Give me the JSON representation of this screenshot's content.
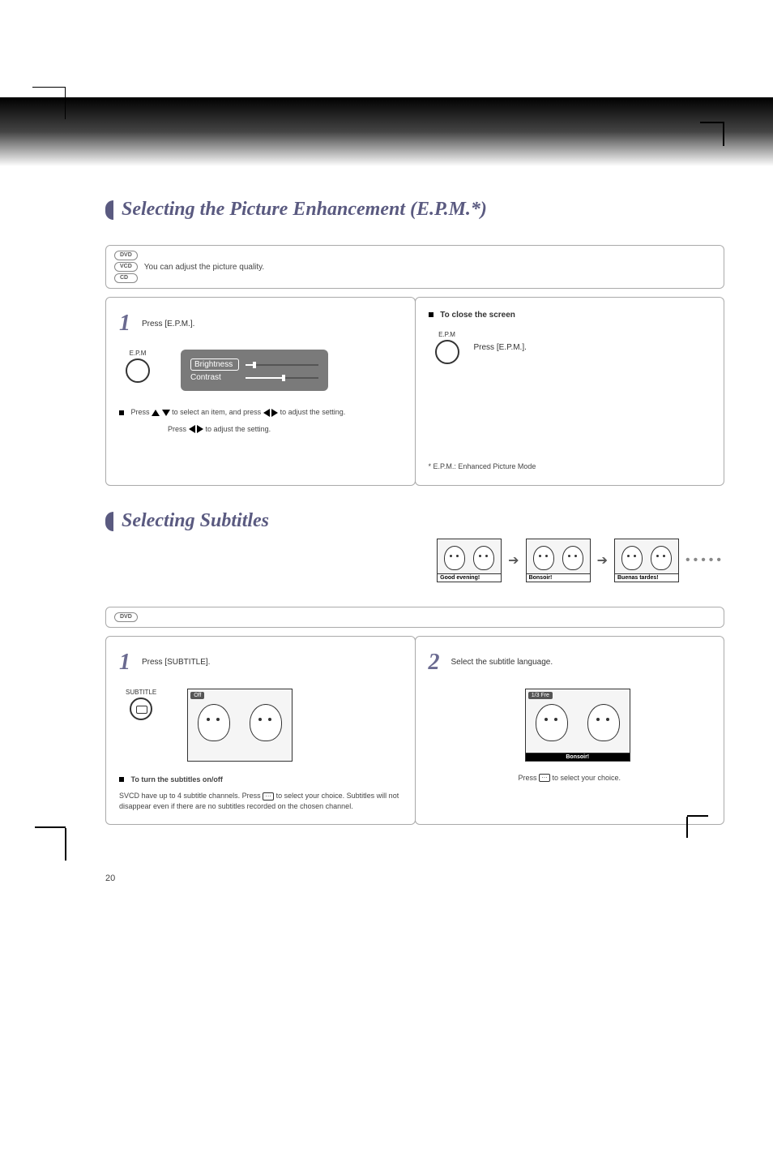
{
  "header": {
    "title1": "Selecting the Picture Enhancement (E.P.M.*)",
    "title2": "Selecting Subtitles"
  },
  "section1": {
    "bar_text": "You can adjust the picture quality.",
    "formats": [
      "DVD",
      "VCD",
      "CD"
    ],
    "step1_num": "1",
    "step1_text": "Press [E.P.M.].",
    "btn1_label": "E.P.M",
    "osd": {
      "brightness": "Brightness",
      "contrast": "Contrast"
    },
    "bullet1a": "Press ",
    "bullet1b": " to select an item, and press ",
    "bullet1c": " to adjust the setting.",
    "bullet2a": "Press ",
    "bullet2b": " to adjust the setting.",
    "note_prefix": "To close the screen",
    "step_note": "Press [E.P.M.].",
    "btn2_label": "E.P.M",
    "footnote": "* E.P.M.: Enhanced Picture Mode"
  },
  "section2": {
    "formats": [
      "DVD"
    ],
    "strip": {
      "cap1": "Good evening!",
      "cap2": "Bonsoir!",
      "cap3": "Buenas tardes!"
    },
    "step1_num": "1",
    "step1_text": "Press [SUBTITLE].",
    "btn_label": "SUBTITLE",
    "cartoon1_osd": "Off",
    "note_prefix": "To turn the subtitles on/off",
    "note_text_a": "SVCD have up to 4 subtitle channels. Press ",
    "note_text_b": " to select your choice. Subtitles will not disappear even if there are no subtitles recorded on the chosen channel.",
    "step2_num": "2",
    "step2_text": "Select the subtitle language.",
    "cartoon2_osd": "1/3 Fre",
    "cartoon2_cap": "Bonsoir!",
    "caption2a": "Press ",
    "caption2b": " to select your choice."
  },
  "page_number": "20"
}
